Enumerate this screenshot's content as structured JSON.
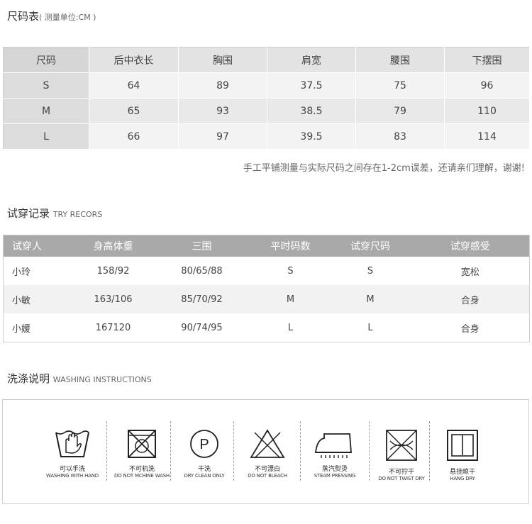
{
  "size_section": {
    "title": "尺码表",
    "subtitle": "( 测量单位:CM )",
    "headers": [
      "尺码",
      "后中衣长",
      "胸围",
      "肩宽",
      "腰围",
      "下摆围"
    ],
    "rows": [
      [
        "S",
        "64",
        "89",
        "37.5",
        "75",
        "96"
      ],
      [
        "M",
        "65",
        "93",
        "38.5",
        "79",
        "110"
      ],
      [
        "L",
        "66",
        "97",
        "39.5",
        "83",
        "114"
      ]
    ],
    "note": "手工平铺测量与实际尺码之间存在1-2cm误差，还请亲们理解，谢谢!"
  },
  "fit_section": {
    "title": "试穿记录",
    "subtitle": "TRY RECORS",
    "headers": [
      "试穿人",
      "身高体重",
      "三围",
      "平时码数",
      "试穿尺码",
      "试穿感受"
    ],
    "rows": [
      [
        "小玲",
        "158/92",
        "80/65/88",
        "S",
        "S",
        "宽松"
      ],
      [
        "小敏",
        "163/106",
        "85/70/92",
        "M",
        "M",
        "合身"
      ],
      [
        "小媛",
        "167120",
        "90/74/95",
        "L",
        "L",
        "合身"
      ]
    ]
  },
  "wash_section": {
    "title": "洗涤说明",
    "subtitle": "WASHING INSTRUCTIONS",
    "items": [
      {
        "icon": "hand-wash-icon",
        "cn": "可以手洗",
        "en": "WASHING WITH HAND"
      },
      {
        "icon": "no-machine-wash-icon",
        "cn": "不可机洗",
        "en": "DO NOT MCHINE WASH"
      },
      {
        "icon": "dry-clean-icon",
        "cn": "干洗",
        "en": "DRY CLEAN ONLY"
      },
      {
        "icon": "no-bleach-icon",
        "cn": "不可漂白",
        "en": "DO NOT BLEACH"
      },
      {
        "icon": "steam-iron-icon",
        "cn": "蒸汽熨烫",
        "en": "STEAM PRESSING"
      },
      {
        "icon": "no-wring-icon",
        "cn": "不可拧干",
        "en": "DO NOT TWIST DRY"
      },
      {
        "icon": "hang-dry-icon",
        "cn": "悬挂晾干",
        "en": "HANG DRY"
      }
    ]
  }
}
